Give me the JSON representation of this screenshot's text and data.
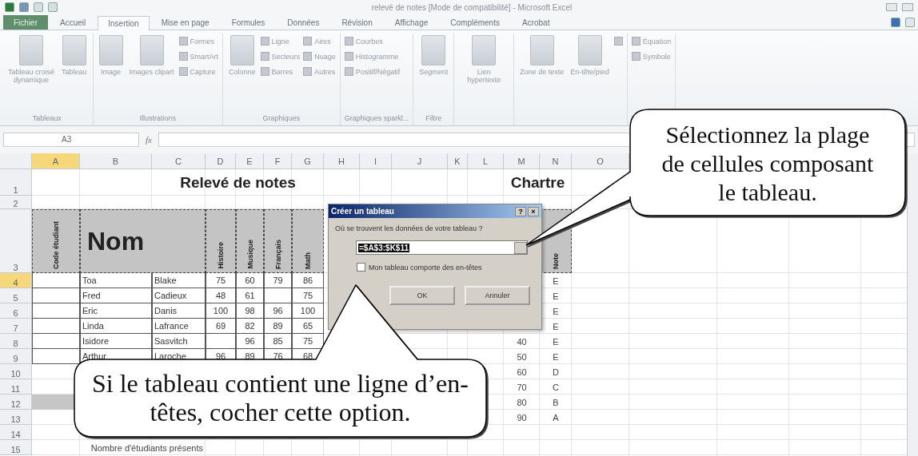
{
  "window": {
    "title": "relevé de notes [Mode de compatibilité] - Microsoft Excel"
  },
  "ribbon": {
    "tabs": [
      {
        "label": "Fichier",
        "kind": "file",
        "selected": false
      },
      {
        "label": "Accueil",
        "kind": "tab",
        "selected": false
      },
      {
        "label": "Insertion",
        "kind": "tab",
        "selected": true
      },
      {
        "label": "Mise en page",
        "kind": "tab",
        "selected": false
      },
      {
        "label": "Formules",
        "kind": "tab",
        "selected": false
      },
      {
        "label": "Données",
        "kind": "tab",
        "selected": false
      },
      {
        "label": "Révision",
        "kind": "tab",
        "selected": false
      },
      {
        "label": "Affichage",
        "kind": "tab",
        "selected": false
      },
      {
        "label": "Compléments",
        "kind": "tab",
        "selected": false
      },
      {
        "label": "Acrobat",
        "kind": "tab",
        "selected": false
      }
    ],
    "groups": [
      {
        "label": "Tableaux",
        "items": [
          {
            "label": "Tableau croisé dynamique",
            "kind": "large"
          },
          {
            "label": "Tableau",
            "kind": "large"
          }
        ]
      },
      {
        "label": "Illustrations",
        "items": [
          {
            "label": "Image",
            "kind": "large"
          },
          {
            "label": "Images clipart",
            "kind": "large"
          },
          {
            "label": "Formes",
            "kind": "small"
          },
          {
            "label": "SmartArt",
            "kind": "small"
          },
          {
            "label": "Capture",
            "kind": "small"
          }
        ]
      },
      {
        "label": "Graphiques",
        "items": [
          {
            "label": "Colonne",
            "kind": "large"
          },
          {
            "label": "Ligne",
            "kind": "small"
          },
          {
            "label": "Secteurs",
            "kind": "small"
          },
          {
            "label": "Barres",
            "kind": "small"
          },
          {
            "label": "Aires",
            "kind": "small"
          },
          {
            "label": "Nuage",
            "kind": "small"
          },
          {
            "label": "Autres",
            "kind": "small"
          }
        ]
      },
      {
        "label": "Graphiques sparkl...",
        "items": [
          {
            "label": "Courbes",
            "kind": "small"
          },
          {
            "label": "Histogramme",
            "kind": "small"
          },
          {
            "label": "Positif/Négatif",
            "kind": "small"
          }
        ]
      },
      {
        "label": "Filtre",
        "items": [
          {
            "label": "Segment",
            "kind": "large"
          }
        ]
      },
      {
        "items": [
          {
            "label": "Lien hypertexte",
            "kind": "large"
          }
        ]
      },
      {
        "items": [
          {
            "label": "Zone de texte",
            "kind": "large"
          },
          {
            "label": "En-tête/pied",
            "kind": "large"
          },
          {
            "kind": "icon"
          }
        ]
      },
      {
        "items": [
          {
            "label": "Équation",
            "kind": "small"
          },
          {
            "label": "Symbole",
            "kind": "small"
          }
        ]
      }
    ]
  },
  "formula_bar": {
    "name_box": "A3",
    "fx": "fx"
  },
  "sheet": {
    "columns": [
      {
        "label": "A",
        "selected": true
      },
      {
        "label": "B",
        "selected": false
      },
      {
        "label": "C",
        "selected": false
      },
      {
        "label": "D",
        "selected": false
      },
      {
        "label": "E",
        "selected": false
      },
      {
        "label": "F",
        "selected": false
      },
      {
        "label": "G",
        "selected": false
      },
      {
        "label": "H",
        "selected": false
      },
      {
        "label": "I",
        "selected": false
      },
      {
        "label": "J",
        "selected": false
      },
      {
        "label": "K",
        "selected": false
      },
      {
        "label": "L",
        "selected": false
      },
      {
        "label": "M",
        "selected": false
      },
      {
        "label": "N",
        "selected": false
      },
      {
        "label": "O",
        "selected": false
      }
    ],
    "rows": [
      {
        "label": "1",
        "selected": false,
        "shaded": false
      },
      {
        "label": "2",
        "selected": false,
        "shaded": false
      },
      {
        "label": "3",
        "selected": false,
        "shaded": false
      },
      {
        "label": "4",
        "selected": true,
        "shaded": false
      },
      {
        "label": "5",
        "selected": false,
        "shaded": false
      },
      {
        "label": "6",
        "selected": false,
        "shaded": false
      },
      {
        "label": "7",
        "selected": false,
        "shaded": false
      },
      {
        "label": "8",
        "selected": false,
        "shaded": false
      },
      {
        "label": "9",
        "selected": false,
        "shaded": false
      },
      {
        "label": "10",
        "selected": false,
        "shaded": false
      },
      {
        "label": "11",
        "selected": false,
        "shaded": false
      },
      {
        "label": "12",
        "selected": false,
        "shaded": true
      },
      {
        "label": "13",
        "selected": false,
        "shaded": false
      },
      {
        "label": "14",
        "selected": false,
        "shaded": false
      },
      {
        "label": "15",
        "selected": false,
        "shaded": false
      }
    ],
    "title": "Relevé de notes",
    "chart_title": "Chartre",
    "headers": {
      "code": "Code étudiant",
      "name": "Nom",
      "subjects": [
        "Histoire",
        "Musique",
        "Français",
        "Math"
      ],
      "note": "Note"
    },
    "students": [
      {
        "first": "Toa",
        "last": "Blake",
        "grades": {
          "histoire": "75",
          "musique": "60",
          "francais": "79",
          "math": "86"
        }
      },
      {
        "first": "Fred",
        "last": "Cadieux",
        "grades": {
          "histoire": "48",
          "musique": "61",
          "math": "75"
        }
      },
      {
        "first": "Eric",
        "last": "Danis",
        "grades": {
          "histoire": "100",
          "musique": "98",
          "francais": "96",
          "math": "100"
        }
      },
      {
        "first": "Linda",
        "last": "Lafrance",
        "grades": {
          "histoire": "69",
          "musique": "82",
          "francais": "89",
          "math": "65"
        }
      },
      {
        "first": "Isidore",
        "last": "Sasvitch",
        "grades": {
          "musique": "96",
          "francais": "85",
          "math": "75"
        }
      },
      {
        "first": "Arthur",
        "last": "Laroche",
        "grades": {
          "histoire": "96",
          "musique": "89",
          "francais": "76",
          "math": "68"
        }
      }
    ],
    "grade_scale": [
      {
        "letter": "E"
      },
      {
        "letter": "E"
      },
      {
        "letter": "E"
      },
      {
        "letter": "E"
      },
      {
        "score": "40",
        "letter": "E"
      },
      {
        "score": "50",
        "letter": "E"
      },
      {
        "score": "60",
        "letter": "D"
      },
      {
        "score": "70",
        "letter": "C"
      },
      {
        "score": "80",
        "letter": "B"
      },
      {
        "score": "90",
        "letter": "A"
      }
    ],
    "footer_label": "Nombre d'étudiants présents"
  },
  "dialog": {
    "title": "Créer un tableau",
    "help": "?",
    "close": "×",
    "question": "Où se trouvent les données de votre tableau ?",
    "range": "=$A$3:$K$11",
    "checkbox": {
      "label": "Mon tableau comporte des en-têtes",
      "checked": false
    },
    "buttons": [
      "OK",
      "Annuler"
    ]
  },
  "callouts": [
    {
      "text": "Sélectionnez la plage de cellules composant le tableau."
    },
    {
      "text": "Si le tableau contient une ligne d’en-têtes, cocher cette option."
    }
  ]
}
